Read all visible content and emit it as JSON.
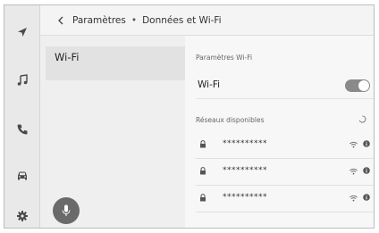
{
  "header": {
    "crumb_1": "Paramètres",
    "separator": "•",
    "crumb_2": "Données et Wi-Fi"
  },
  "menu": {
    "items": [
      {
        "label": "Wi-Fi"
      }
    ]
  },
  "settings": {
    "section_title": "Paramètres Wi-Fi",
    "wifi_label": "Wi-Fi",
    "wifi_enabled": true,
    "networks_title": "Réseaux disponibles",
    "networks": [
      {
        "name": "**********"
      },
      {
        "name": "**********"
      },
      {
        "name": "**********"
      }
    ]
  },
  "rail": {
    "icons": [
      "navigation-icon",
      "music-icon",
      "phone-icon",
      "car-icon",
      "settings-gear-icon"
    ]
  },
  "colors": {
    "toggle_on": "#8a8a8a",
    "mic_button": "#6a6a6a",
    "selected_item": "#e2e2e2"
  }
}
